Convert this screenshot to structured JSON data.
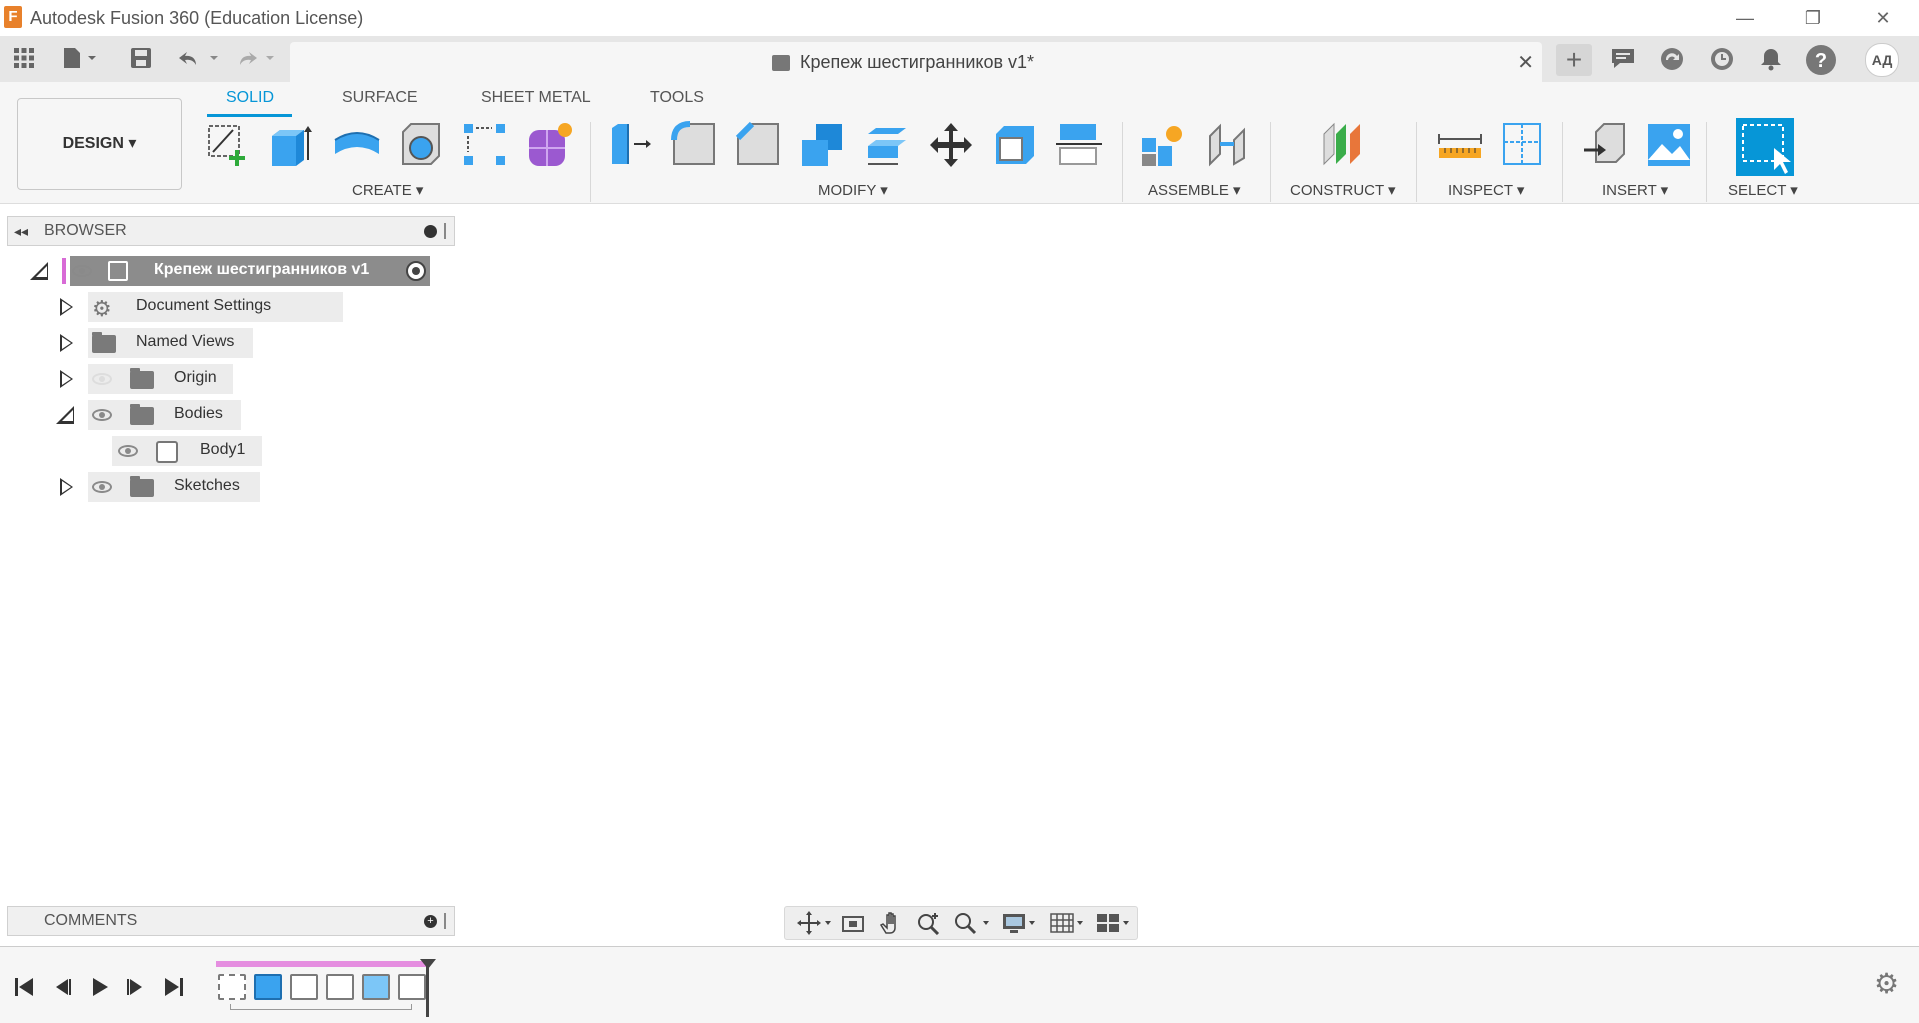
{
  "window": {
    "title": "Autodesk Fusion 360 (Education License)",
    "logo_letter": "F",
    "minimize": "—",
    "restore": "❐",
    "close": "✕"
  },
  "tabbar": {
    "document_tab_title": "Крепеж шестигранников v1*",
    "close_glyph": "✕",
    "user_initials": "АД",
    "new_tab_glyph": "+",
    "help_glyph": "?"
  },
  "toolbar": {
    "workspace_button": "DESIGN ▾",
    "tabs": [
      "SOLID",
      "SURFACE",
      "SHEET METAL",
      "TOOLS"
    ],
    "active_tab": "SOLID",
    "groups": {
      "create": "CREATE ▾",
      "modify": "MODIFY ▾",
      "assemble": "ASSEMBLE ▾",
      "construct": "CONSTRUCT ▾",
      "inspect": "INSPECT ▾",
      "insert": "INSERT ▾",
      "select": "SELECT ▾"
    },
    "accent_color": "#0696d7"
  },
  "browser": {
    "header": "BROWSER",
    "collapse_glyph": "◂◂",
    "root": "Крепеж шестигранников v1",
    "items": [
      {
        "label": "Document Settings"
      },
      {
        "label": "Named Views"
      },
      {
        "label": "Origin"
      },
      {
        "label": "Bodies"
      },
      {
        "label": "Body1"
      },
      {
        "label": "Sketches"
      }
    ]
  },
  "comments": {
    "header": "COMMENTS"
  },
  "timeline": {
    "first": "⏮",
    "prev": "◀",
    "play": "▶",
    "next": "▶",
    "last": "⏭"
  }
}
